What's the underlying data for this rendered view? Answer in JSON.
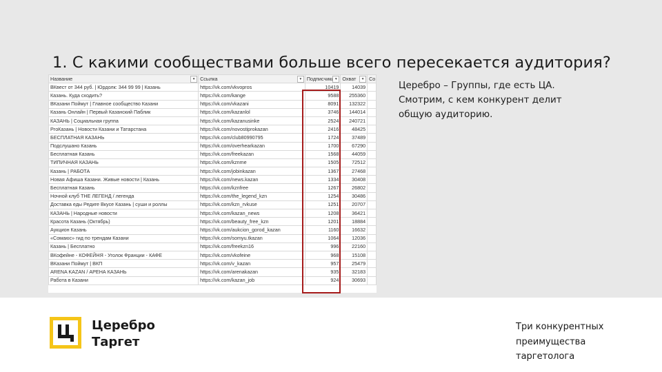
{
  "slide": {
    "title": "1. С какими сообществами больше всего пересекается аудитория?"
  },
  "table": {
    "headers": [
      "Название",
      "Ссылка",
      "Подписчики",
      "Охват",
      "Со"
    ],
    "rows": [
      {
        "name": "ВКвест от 344 руб. | Юрдолк: 344 99 99 | Казань",
        "link": "https://vk.com/vkvopros",
        "subs": "10419",
        "reach": "14039"
      },
      {
        "name": "Казань. Куда сходить?",
        "link": "https://vk.com/kange",
        "subs": "9588",
        "reach": "255360"
      },
      {
        "name": "ВКазани Поймут | Главное сообщество Казани",
        "link": "https://vk.com/vkazani",
        "subs": "8091",
        "reach": "132322"
      },
      {
        "name": "Казань Онлайн | Первый Казанский Паблик",
        "link": "https://vk.com/kazanlol",
        "subs": "3746",
        "reach": "144014"
      },
      {
        "name": "КАЗАНЬ | Социальная группа",
        "link": "https://vk.com/kazanusinke",
        "subs": "2524",
        "reach": "240721"
      },
      {
        "name": "ProКазань | Новости Казани и Татарстана",
        "link": "https://vk.com/novostiprokazan",
        "subs": "2416",
        "reach": "48425"
      },
      {
        "name": "БЕСПЛАТНАЯ КАЗАНЬ",
        "link": "https://vk.com/club80990795",
        "subs": "1724",
        "reach": "37489"
      },
      {
        "name": "Подслушано Казань",
        "link": "https://vk.com/overhearkazan",
        "subs": "1700",
        "reach": "67290"
      },
      {
        "name": "Бесплатная Казань",
        "link": "https://vk.com/freekazan",
        "subs": "1568",
        "reach": "44059"
      },
      {
        "name": "ТИПИЧНАЯ КАЗАНЬ",
        "link": "https://vk.com/kznme",
        "subs": "1505",
        "reach": "72512"
      },
      {
        "name": "Казань | РАБОТА",
        "link": "https://vk.com/jobinkazan",
        "subs": "1367",
        "reach": "27468"
      },
      {
        "name": "Новая Афиша Казани. Живые новости | Казань",
        "link": "https://vk.com/news.kazan",
        "subs": "1334",
        "reach": "30408"
      },
      {
        "name": "Бесплатная Казань",
        "link": "https://vk.com/kznfree",
        "subs": "1267",
        "reach": "26802"
      },
      {
        "name": "Ночной клуб ТНЕ ЛЕГЕНД / легенда",
        "link": "https://vk.com/the_legend_kzn",
        "subs": "1254",
        "reach": "30486"
      },
      {
        "name": "Доставка еды Редиге Вкусе Казань | суши и роллы",
        "link": "https://vk.com/kzn_rvkuse",
        "subs": "1251",
        "reach": "20707"
      },
      {
        "name": "КАЗАНЬ | Народные новости",
        "link": "https://vk.com/kazan_news",
        "subs": "1208",
        "reach": "36421"
      },
      {
        "name": "Красота Казань (Октябрь)",
        "link": "https://vk.com/beauty_free_kzn",
        "subs": "1201",
        "reach": "18884"
      },
      {
        "name": "Аукцион Казань",
        "link": "https://vk.com/aukcion_gorod_kazan",
        "subs": "1160",
        "reach": "16632"
      },
      {
        "name": "«Сомаюс» гид по трендам Казани",
        "link": "https://vk.com/somyu.tkazan",
        "subs": "1064",
        "reach": "12036"
      },
      {
        "name": "Казань | Бесплатно",
        "link": "https://vk.com/freekzn16",
        "subs": "996",
        "reach": "22160"
      },
      {
        "name": "ВКофейне - КОФЕЙНЯ - Уголок Франции - КАФЕ",
        "link": "https://vk.com/vkofeine",
        "subs": "968",
        "reach": "15108"
      },
      {
        "name": "ВКазани Поймут | ВКП",
        "link": "https://vk.com/v_kazan",
        "subs": "957",
        "reach": "25479"
      },
      {
        "name": "ARENA KAZAN / АРЕНА КАЗАНЬ",
        "link": "https://vk.com/arenakazan",
        "subs": "935",
        "reach": "32183"
      },
      {
        "name": "Работа в Казани",
        "link": "https://vk.com/kazan_job",
        "subs": "924",
        "reach": "30693"
      }
    ]
  },
  "annotation": {
    "lines": [
      "Церебро – Группы, где есть ЦА.",
      "Смотрим, с кем конкурент делит",
      "общую аудиторию."
    ]
  },
  "brand": {
    "logo_letter": "Ц",
    "line1": "Церебро",
    "line2": "Таргет",
    "accent": "#f5c518"
  },
  "footer": {
    "lines": [
      "Три конкурентных",
      "преимущества",
      "таргетолога"
    ]
  },
  "colors": {
    "highlight": "#a51a1a",
    "band": "#e8e8e8"
  }
}
